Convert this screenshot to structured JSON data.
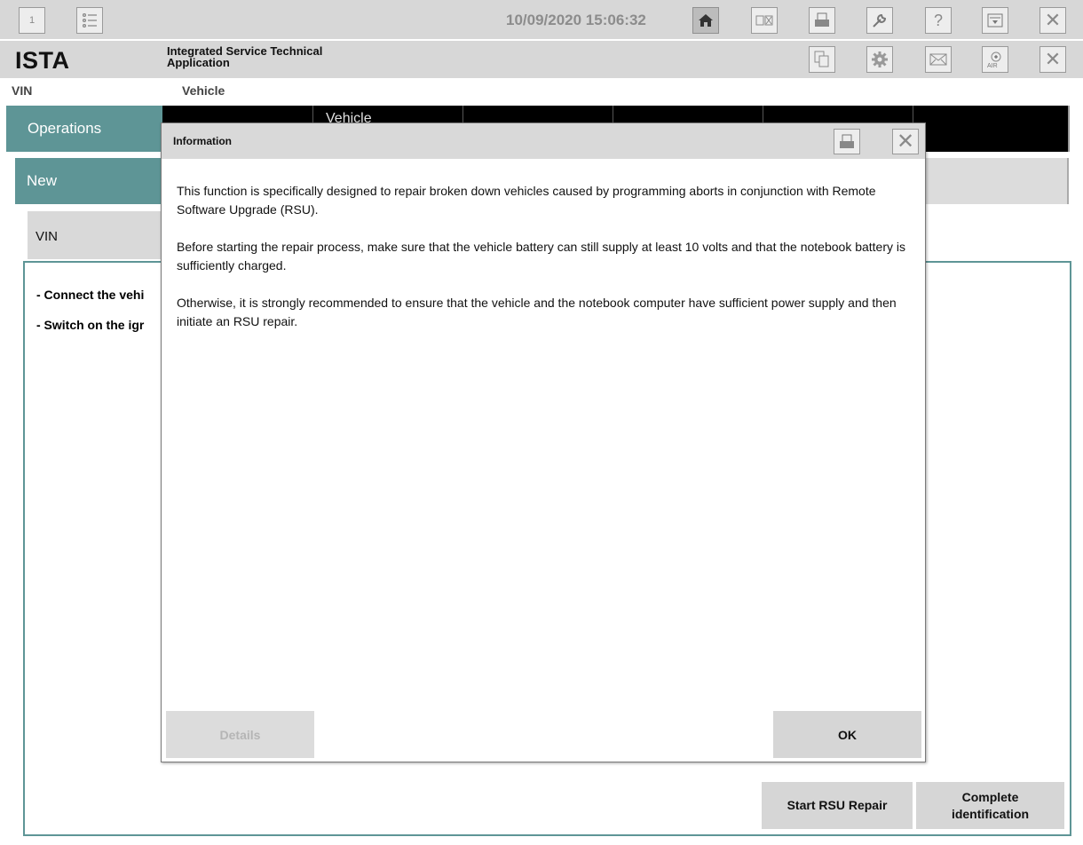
{
  "toolbar": {
    "window_number": "1",
    "datetime": "10/09/2020 15:06:32",
    "icons": [
      "list-icon",
      "home-icon",
      "split-view-icon",
      "print-icon",
      "wrench-icon",
      "help-icon",
      "download-icon",
      "close-icon"
    ]
  },
  "app": {
    "logo": "ISTA",
    "name": "Integrated Service Technical Application",
    "icons": [
      "copy-icon",
      "gear-icon",
      "mail-icon",
      "air-icon",
      "close-icon"
    ]
  },
  "labels": {
    "vin": "VIN",
    "vehicle": "Vehicle"
  },
  "nav": {
    "operations": "Operations",
    "cells": [
      "",
      "Vehicle",
      "",
      "",
      "",
      ""
    ]
  },
  "subnav": {
    "new": "New"
  },
  "tabs": {
    "vin": "VIN"
  },
  "content": {
    "instructions": [
      "- Connect the vehi",
      "- Switch on the igr"
    ],
    "buttons": {
      "start_rsu": "Start RSU Repair",
      "complete_id": "Complete identification"
    }
  },
  "dialog": {
    "title": "Information",
    "paragraphs": [
      "This function is specifically designed to repair broken down vehicles caused by programming aborts in conjunction with Remote Software Upgrade (RSU).",
      "Before starting the repair process, make sure that the vehicle battery can still supply at least 10 volts and that the notebook battery is sufficiently charged.",
      "Otherwise, it is strongly recommended to ensure that the vehicle and the notebook computer have sufficient power supply and then initiate an RSU repair."
    ],
    "buttons": {
      "details": "Details",
      "ok": "OK"
    }
  },
  "colors": {
    "teal": "#5e9596",
    "toolbar_gray": "#d7d7d7",
    "button_gray": "#d6d6d6",
    "black_nav": "#000000"
  }
}
